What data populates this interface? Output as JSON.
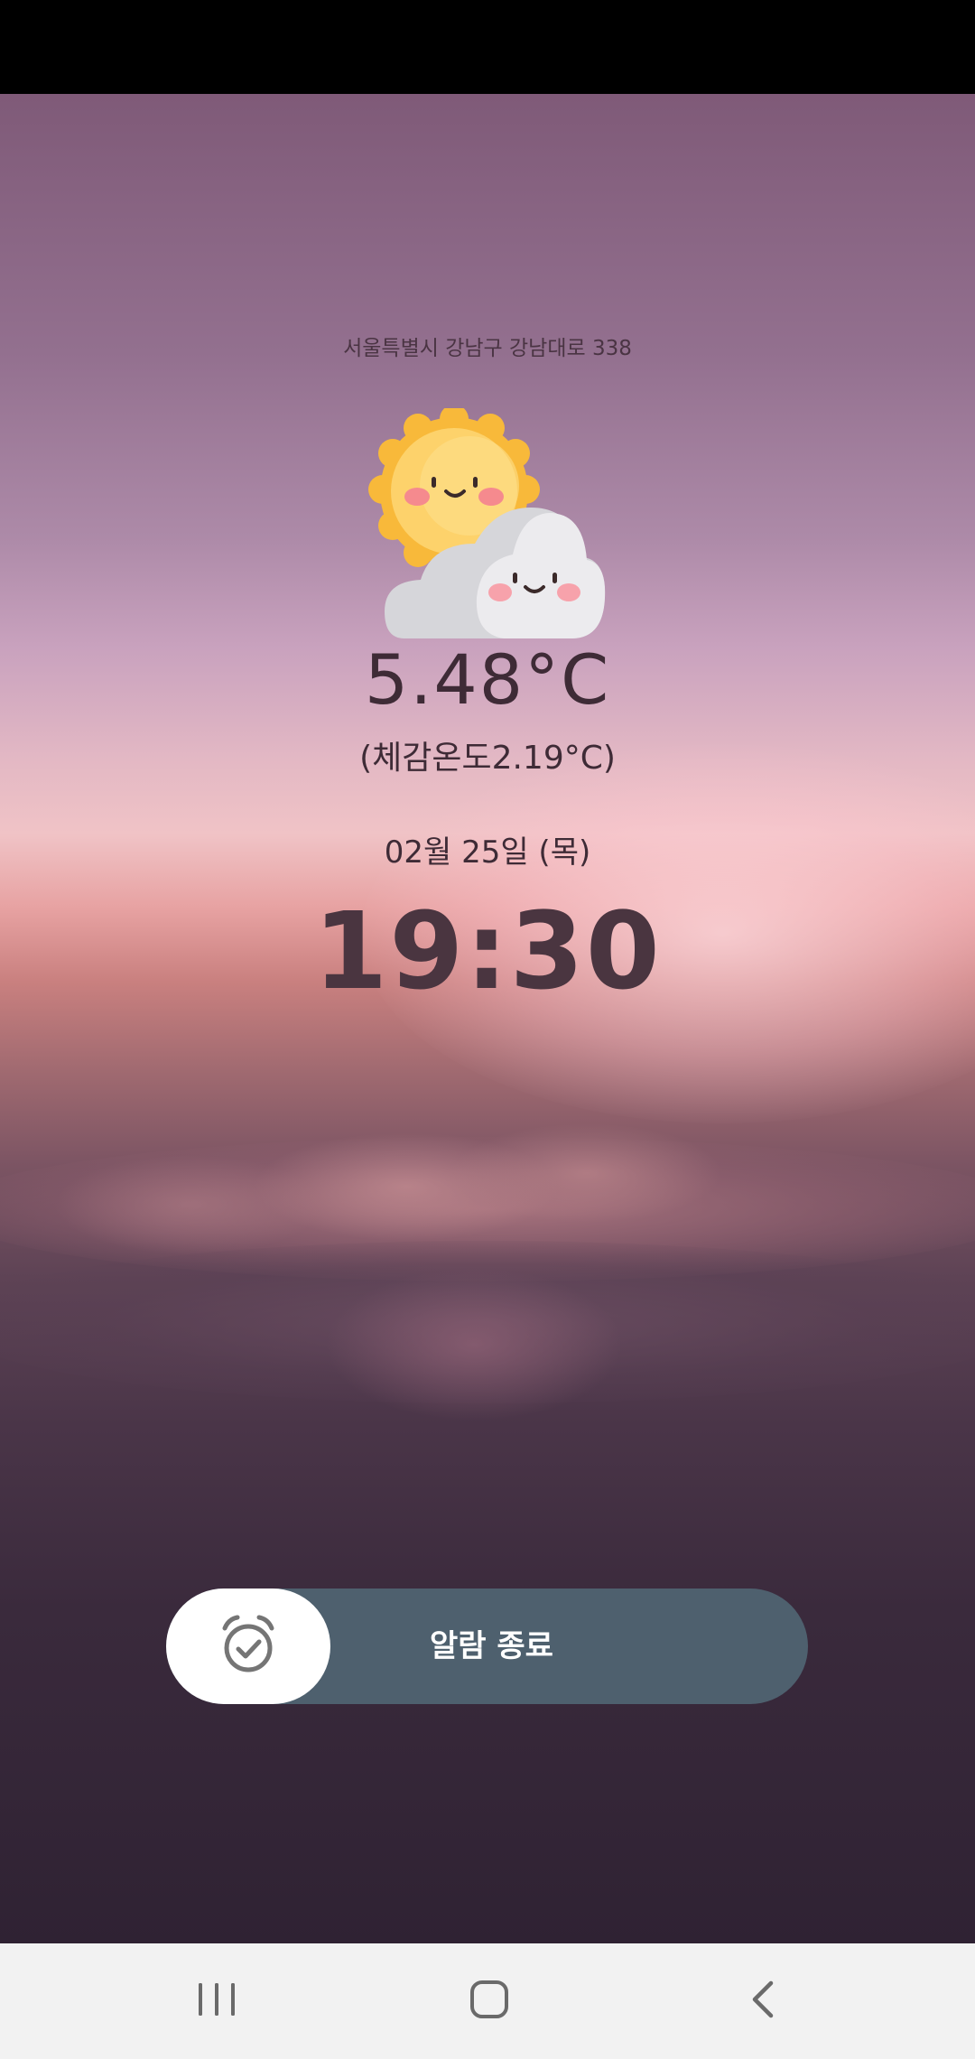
{
  "weather": {
    "address": "서울특별시 강남구 강남대로 338",
    "icon": "sun-behind-cloud-icon",
    "temperature": "5.48°C",
    "feels_like": "(체감온도2.19°C)"
  },
  "clock": {
    "date": "02월 25일 (목)",
    "time": "19:30"
  },
  "alarm": {
    "dismiss_label": "알람 종료",
    "knob_icon": "alarm-clock-check-icon"
  },
  "navigation": {
    "recents_icon": "recents-icon",
    "home_icon": "home-icon",
    "back_icon": "back-icon"
  },
  "colors": {
    "slider_track": "#4e606e",
    "slider_knob": "#ffffff",
    "text_dark": "#3e2b36",
    "nav_bar": "#f2f2f2"
  }
}
